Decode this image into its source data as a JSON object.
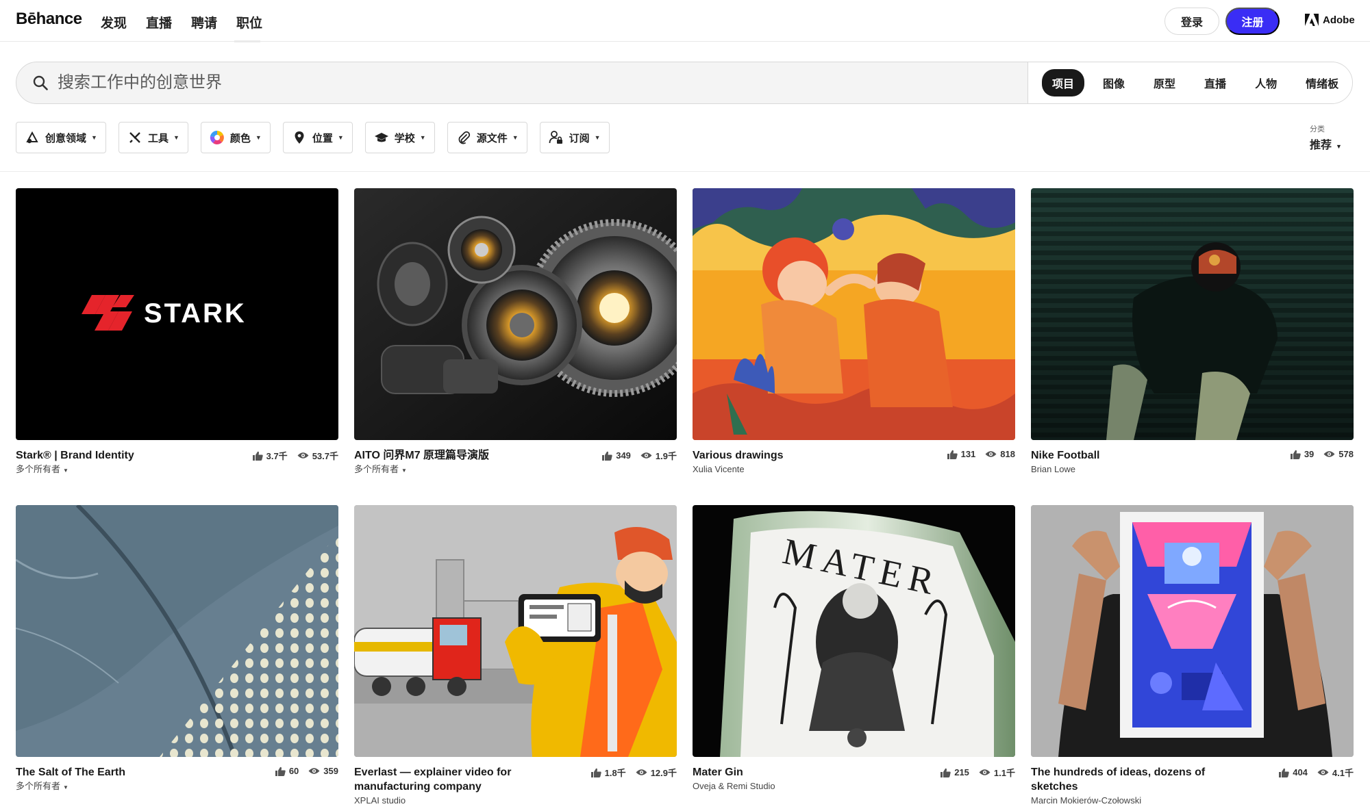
{
  "nav": {
    "logo": "Bēhance",
    "links": [
      "发现",
      "直播",
      "聘请",
      "职位"
    ],
    "login": "登录",
    "signup": "注册",
    "adobe": "Adobe"
  },
  "search": {
    "placeholder": "搜索工作中的创意世界",
    "tabs": [
      "项目",
      "图像",
      "原型",
      "直播",
      "人物",
      "情绪板"
    ],
    "active_tab": "项目"
  },
  "filters": [
    {
      "label": "创意领域",
      "icon": "creative-fields-icon"
    },
    {
      "label": "工具",
      "icon": "tools-icon"
    },
    {
      "label": "颜色",
      "icon": "color-wheel-icon"
    },
    {
      "label": "位置",
      "icon": "location-pin-icon"
    },
    {
      "label": "学校",
      "icon": "school-cap-icon"
    },
    {
      "label": "源文件",
      "icon": "paperclip-icon"
    },
    {
      "label": "订阅",
      "icon": "subscription-icon"
    }
  ],
  "sort": {
    "label": "分类",
    "value": "推荐"
  },
  "projects": [
    {
      "title": "Stark® | Brand Identity",
      "owner": "多个所有者",
      "multi_owner": true,
      "likes": "3.7千",
      "views": "53.7千",
      "thumb_text": "STARK"
    },
    {
      "title": "AITO 问界M7 原理篇导演版",
      "owner": "多个所有者",
      "multi_owner": true,
      "likes": "349",
      "views": "1.9千"
    },
    {
      "title": "Various drawings",
      "owner": "Xulia Vicente",
      "multi_owner": false,
      "likes": "131",
      "views": "818"
    },
    {
      "title": "Nike Football",
      "owner": "Brian Lowe",
      "multi_owner": false,
      "likes": "39",
      "views": "578"
    },
    {
      "title": "The Salt of The Earth",
      "owner": "多个所有者",
      "multi_owner": true,
      "likes": "60",
      "views": "359"
    },
    {
      "title": "Everlast — explainer video for manufacturing company",
      "owner": "XPLAI studio",
      "multi_owner": false,
      "likes": "1.8千",
      "views": "12.9千"
    },
    {
      "title": "Mater Gin",
      "owner": "Oveja & Remi Studio",
      "multi_owner": false,
      "likes": "215",
      "views": "1.1千",
      "thumb_text": "MATER"
    },
    {
      "title": "The hundreds of ideas, dozens of sketches",
      "owner": "Marcin Mokierów-Czołowski",
      "multi_owner": false,
      "likes": "404",
      "views": "4.1千"
    }
  ],
  "colors": {
    "accent": "#3a2df5",
    "stark_red": "#e5242b"
  }
}
